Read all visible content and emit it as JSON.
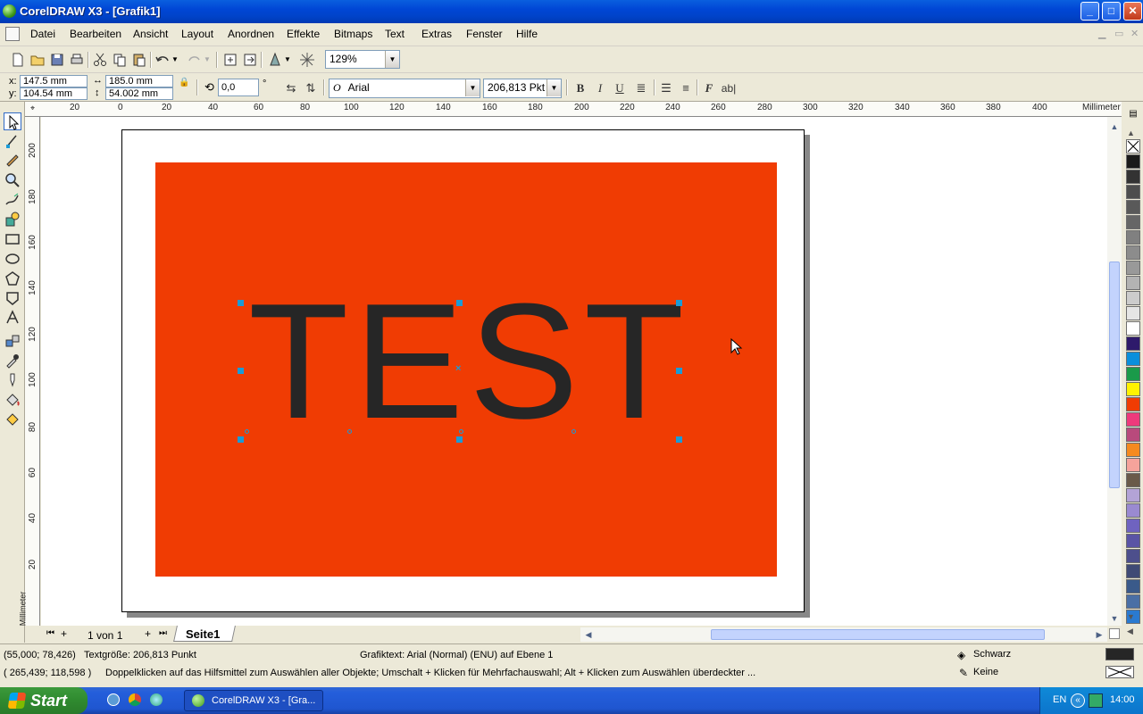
{
  "window": {
    "title": "CorelDRAW X3 - [Grafik1]",
    "minimize": "_",
    "maximize": "□",
    "close": "✕"
  },
  "menu": [
    "Datei",
    "Bearbeiten",
    "Ansicht",
    "Layout",
    "Anordnen",
    "Effekte",
    "Bitmaps",
    "Text",
    "Extras",
    "Fenster",
    "Hilfe"
  ],
  "toolbar": {
    "zoom": "129%"
  },
  "property_bar": {
    "x_label": "x:",
    "x_value": "147.5 mm",
    "y_label": "y:",
    "y_value": "104.54 mm",
    "width": "185.0 mm",
    "height": "54.002 mm",
    "rotation": "0,0",
    "degree": "°",
    "font_glyph": "O",
    "font": "Arial",
    "font_size": "206,813 Pkt",
    "bold": "B",
    "italic": "I",
    "underline": "U",
    "char_fmt": "F",
    "edit_text": "ab|"
  },
  "ruler": {
    "unit": "Millimeter",
    "h_ticks": [
      "20",
      "0",
      "20",
      "40",
      "60",
      "80",
      "100",
      "120",
      "140",
      "160",
      "180",
      "200",
      "220",
      "240",
      "260",
      "280",
      "300",
      "320",
      "340",
      "360",
      "380",
      "400"
    ],
    "v_ticks": [
      "200",
      "180",
      "160",
      "140",
      "120",
      "100",
      "80",
      "60",
      "40",
      "20"
    ],
    "v_unit": "Millimeter"
  },
  "canvas": {
    "text": "TEST",
    "rect_color": "#f03c03",
    "text_color": "#262626"
  },
  "page_nav": {
    "page_count": "1 von 1",
    "tab": "Seite1"
  },
  "status": {
    "coords": "(55,000; 78,426)",
    "text_size": "Textgröße: 206,813 Punkt",
    "object_info": "Grafiktext: Arial (Normal) (ENU) auf Ebene 1",
    "cursor": "( 265,439; 118,598 )",
    "hint": "Doppelklicken auf das Hilfsmittel zum Auswählen aller Objekte; Umschalt + Klicken für Mehrfachauswahl; Alt + Klicken zum Auswählen überdeckter ...",
    "fill": "Schwarz",
    "outline": "Keine"
  },
  "palette": [
    "#1a1a1a",
    "#333333",
    "#4d4d4d",
    "#595959",
    "#666666",
    "#808080",
    "#8c8c8c",
    "#999999",
    "#b3b3b3",
    "#cccccc",
    "#e5e5e5",
    "#ffffff",
    "#2e1a6b",
    "#0a8fdc",
    "#1a9a4a",
    "#fff200",
    "#f03c03",
    "#ee3a7c",
    "#b84a7c",
    "#f58a1f",
    "#f5a39b",
    "#6a5a4a",
    "#b3a3d6",
    "#9a8ad1",
    "#6f63c0",
    "#5a54a5",
    "#4d4f8c",
    "#3f4a75",
    "#3a5a8a",
    "#4a6fa5",
    "#2a7ad0"
  ],
  "taskbar": {
    "start": "Start",
    "active_task": "CorelDRAW X3 - [Gra...",
    "lang": "EN",
    "clock": "14:00"
  }
}
